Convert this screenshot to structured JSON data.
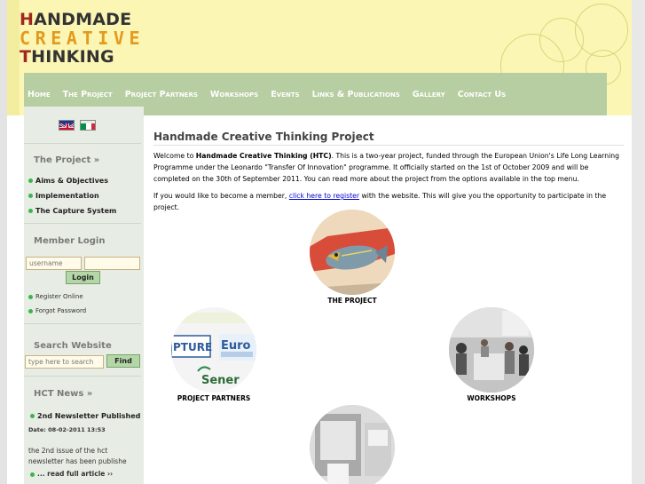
{
  "logo": {
    "line1_first": "H",
    "line1_rest": "ANDMADE",
    "line2": "CREATIVE",
    "line3_first": "T",
    "line3_rest": "HINKING"
  },
  "nav": {
    "items": [
      "Home",
      "The Project",
      "Project Partners",
      "Workshops",
      "Events",
      "Links & Publications",
      "Gallery",
      "Contact Us"
    ]
  },
  "sidebar": {
    "languages": [
      "English",
      "Italiano"
    ],
    "project_title": "The Project »",
    "project_links": [
      "Aims & Objectives",
      "Implementation",
      "The Capture System"
    ],
    "member_title": "Member Login",
    "username_placeholder": "username",
    "login_label": "Login",
    "member_links": [
      "Register Online",
      "Forgot Password"
    ],
    "search_title": "Search Website",
    "search_placeholder": "type here to search",
    "find_label": "Find",
    "news_title": "HCT News »",
    "news_headline": "2nd Newsletter Published",
    "news_date": "Date: 08-02-2011 13:53",
    "news_text_1": "the 2nd issue of the hct",
    "news_text_2": "newsletter has been publishe",
    "news_more": "... read full article ››"
  },
  "main": {
    "title": "Handmade Creative Thinking Project",
    "intro_1": "Welcome to ",
    "intro_bold": "Handmade Creative Thinking (HTC)",
    "intro_2": ".  This is a two-year project, funded through the European Union's Life Long Learning Programme under the Leonardo \"Transfer Of Innovation\" programme. It officially started on the 1st of October 2009 and will be completed on the 30th of September 2011.  You can read more about the project from the options available in the top menu.",
    "member_1": "If you would like to become a member, ",
    "member_link": "click here to register",
    "member_2": " with the website.  This will give you the opportunity to participate in the project.",
    "thumbs": [
      "THE PROJECT",
      "PROJECT PARTNERS",
      "WORKSHOPS"
    ],
    "partner_logo_texts": [
      "PTURE",
      "Euro",
      "Sener"
    ]
  },
  "colors": {
    "nav_bg": "#b7cea2",
    "header_bg": "#fcf6b4",
    "sidebar_bg": "#e7ece4",
    "accent_orange": "#e39a1d",
    "accent_red": "#a0281e",
    "link_blue": "#0000cc"
  }
}
